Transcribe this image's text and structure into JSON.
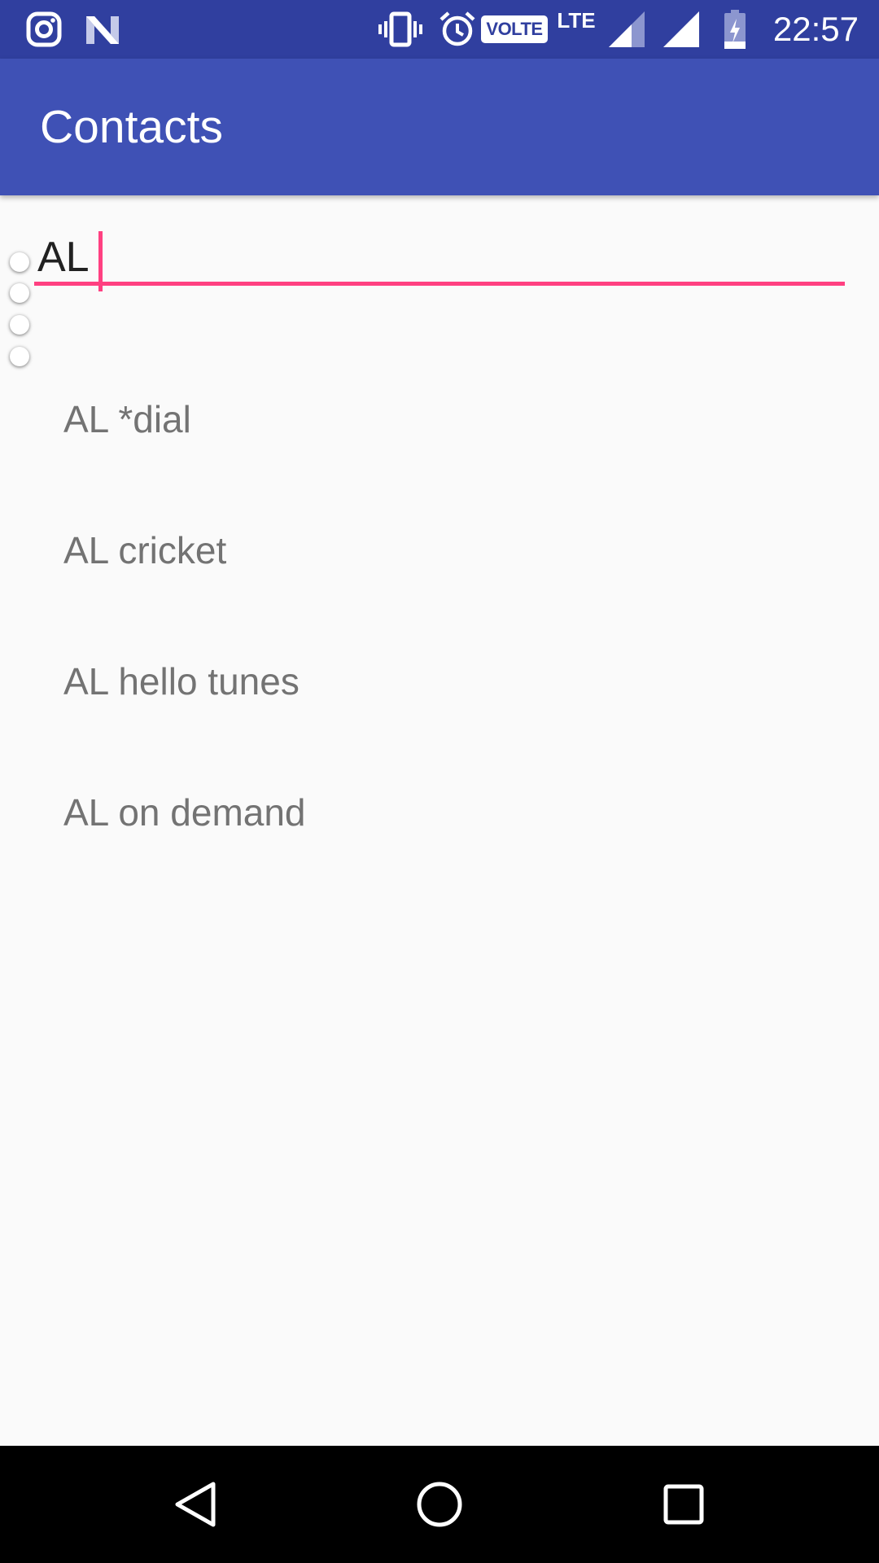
{
  "status_bar": {
    "time": "22:57",
    "volte_label": "VOLTE",
    "network_label": "LTE",
    "icons": [
      "instagram-icon",
      "n-notification-icon",
      "vibrate-icon",
      "alarm-icon",
      "volte-icon",
      "lte-icon",
      "signal-icon",
      "signal-icon",
      "battery-charging-icon"
    ]
  },
  "app_bar": {
    "title": "Contacts"
  },
  "search": {
    "value": "AL "
  },
  "suggestions": [
    {
      "label": "AL *dial"
    },
    {
      "label": "AL cricket"
    },
    {
      "label": "AL hello tunes"
    },
    {
      "label": "AL on demand"
    }
  ],
  "nav_bar": {
    "icons": [
      "back-icon",
      "home-icon",
      "recents-icon"
    ]
  },
  "colors": {
    "status_bar": "#303f9f",
    "app_bar": "#3f51b5",
    "accent": "#ff4081",
    "background": "#fafafa",
    "suggestion_text": "#737373"
  }
}
